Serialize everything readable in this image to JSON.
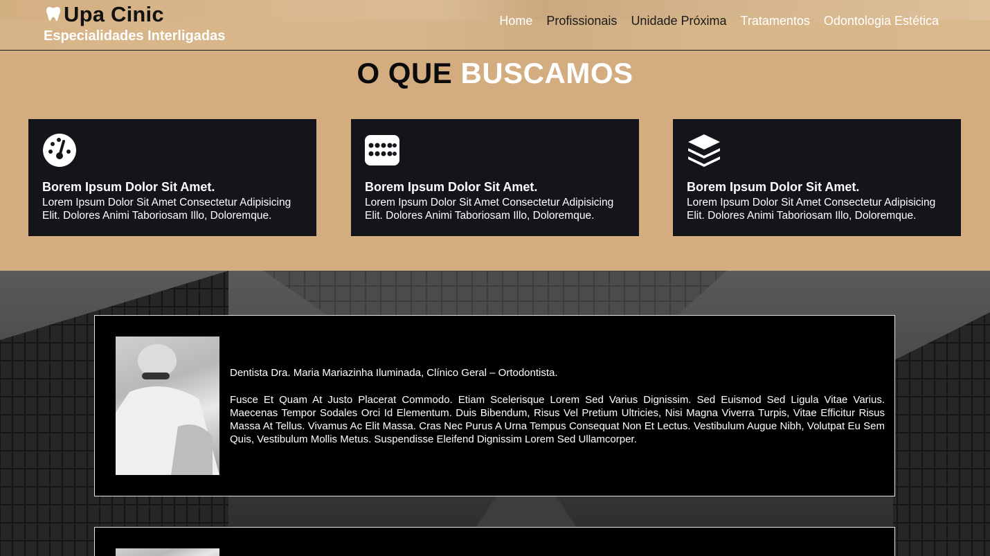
{
  "header": {
    "title": "Upa Cinic",
    "subtitle": "Especialidades Interligadas",
    "nav": [
      {
        "label": "Home"
      },
      {
        "label": "Profissionais"
      },
      {
        "label": "Unidade Próxima"
      },
      {
        "label": "Tratamentos"
      },
      {
        "label": "Odontologia Estética"
      }
    ]
  },
  "section": {
    "title_part1": "O QUE",
    "title_part2": "BUSCAMOS",
    "cards": [
      {
        "icon": "gauge-icon",
        "title": "Borem Ipsum Dolor Sit Amet.",
        "text": "Lorem Ipsum Dolor Sit Amet Consectetur Adipisicing Elit. Dolores Animi Taboriosam Illo, Doloremque."
      },
      {
        "icon": "keypad-icon",
        "title": "Borem Ipsum Dolor Sit Amet.",
        "text": "Lorem Ipsum Dolor Sit Amet Consectetur Adipisicing Elit. Dolores Animi Taboriosam Illo, Doloremque."
      },
      {
        "icon": "layers-icon",
        "title": "Borem Ipsum Dolor Sit Amet.",
        "text": "Lorem Ipsum Dolor Sit Amet Consectetur Adipisicing Elit. Dolores Animi Taboriosam Illo, Doloremque."
      }
    ]
  },
  "profiles": [
    {
      "name": "Dentista Dra. Maria Mariazinha Iluminada, Clínico Geral – Ortodontista.",
      "bio": "Fusce Et Quam At Justo Placerat Commodo. Etiam Scelerisque Lorem Sed Varius Dignissim. Sed Euismod Sed Ligula Vitae Varius. Maecenas Tempor Sodales Orci Id Elementum. Duis Bibendum, Risus Vel Pretium Ultricies, Nisi Magna Viverra Turpis, Vitae Efficitur Risus Massa At Tellus. Vivamus Ac Elit Massa. Cras Nec Purus A Urna Tempus Consequat Non Et Lectus. Vestibulum Augue Nibh, Volutpat Eu Sem Quis, Vestibulum Mollis Metus. Suspendisse Eleifend Dignissim Lorem Sed Ullamcorper."
    }
  ],
  "colors": {
    "accent": "#d3ad7f",
    "card_bg": "#13151b",
    "profile_bg": "#000000"
  }
}
